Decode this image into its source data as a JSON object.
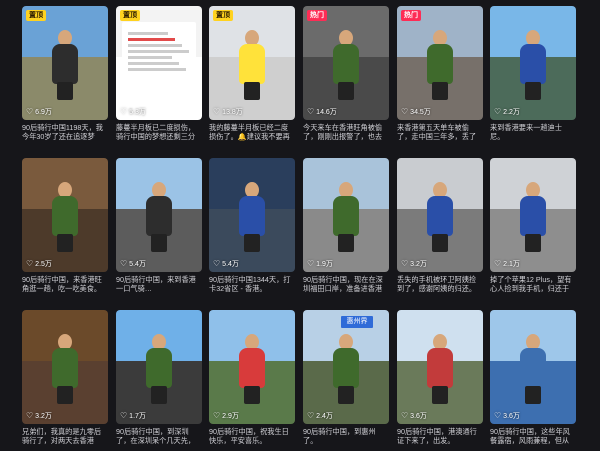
{
  "cards": [
    {
      "badge": "置顶",
      "badge_style": "yellow",
      "likes": "6.9万",
      "caption": "90后骑行中国1198天，我今年30岁了还在追逐梦想，有…",
      "sky": "#6aa2d6",
      "ground": "#8b8a6a",
      "shirt": "#2d2d2d"
    },
    {
      "badge": "置顶",
      "badge_style": "yellow",
      "likes": "5.3万",
      "caption": "藤蔓半月板已二度损伤，骑行中国的梦想还剩三分之一…",
      "sky": "#f3f3f3",
      "ground": "#ffffff",
      "shirt": "#ffffff"
    },
    {
      "badge": "置顶",
      "badge_style": "yellow",
      "likes": "13.8万",
      "caption": "我的藤蔓半月板已经二度损伤了。🔔建议我不要再继续骑…",
      "sky": "#dfe2e6",
      "ground": "#cfcfcf",
      "shirt": "#ffe23a"
    },
    {
      "badge": "热门",
      "badge_style": "red",
      "likes": "14.6万",
      "caption": "今天来车在香港旺角被偷了，刚刚出报警了，也去了趟警…",
      "sky": "#6b6b6b",
      "ground": "#4a4a4a",
      "shirt": "#3f6a2c"
    },
    {
      "badge": "热门",
      "badge_style": "red",
      "likes": "34.5万",
      "caption": "来香港第五天单车被偷了，走中国三年多，丢了32个省份…",
      "sky": "#9fb3c8",
      "ground": "#77706a",
      "shirt": "#3f6a2c"
    },
    {
      "badge": "",
      "badge_style": "yellow",
      "likes": "2.2万",
      "caption": "来到香港要来一趟迪士尼。",
      "sky": "#79b7e8",
      "ground": "#4c6b5a",
      "shirt": "#2a4fa8"
    },
    {
      "badge": "",
      "badge_style": "yellow",
      "likes": "2.5万",
      "caption": "90后骑行中国，来香港旺角逛一趟，吃一吃美食。",
      "sky": "#7a5a3d",
      "ground": "#4d3a2a",
      "shirt": "#3f6a2c"
    },
    {
      "badge": "",
      "badge_style": "yellow",
      "likes": "5.4万",
      "caption": "90后骑行中国，来到香港一口气骑…",
      "sky": "#9bc3e6",
      "ground": "#5c5c5c",
      "shirt": "#2d2d2d"
    },
    {
      "badge": "",
      "badge_style": "yellow",
      "likes": "5.4万",
      "caption": "90后骑行中国1344天，打卡32省区 - 香港。",
      "sky": "#2a3e5c",
      "ground": "#3b4a5c",
      "shirt": "#2a4fa8"
    },
    {
      "badge": "",
      "badge_style": "yellow",
      "likes": "1.9万",
      "caption": "90后骑行中国，现在在深圳福田口岸，准备进香港了，好…",
      "sky": "#a9c3da",
      "ground": "#8a8a8a",
      "shirt": "#3f6a2c"
    },
    {
      "badge": "",
      "badge_style": "yellow",
      "likes": "3.2万",
      "caption": "丢失的手机被环卫阿姨捡到了，感谢阿姨的归还。",
      "sky": "#c9ccd0",
      "ground": "#7b7b7b",
      "shirt": "#2a4fa8"
    },
    {
      "badge": "",
      "badge_style": "yellow",
      "likes": "2.1万",
      "caption": "掉了个苹果12 Plus，望有心人捡到我手机，归还于我。",
      "sky": "#cfd2d6",
      "ground": "#8e8e8e",
      "shirt": "#2a4fa8"
    },
    {
      "badge": "",
      "badge_style": "yellow",
      "likes": "3.2万",
      "caption": "兄弟们，我真的是九零后骑行了，对两天去香港啊。",
      "sky": "#6b4a2a",
      "ground": "#5a4030",
      "shirt": "#3f6a2c"
    },
    {
      "badge": "",
      "badge_style": "yellow",
      "likes": "1.7万",
      "caption": "90后骑行中国，到深圳了，在深圳呆个几天先，然后去香…",
      "sky": "#6fb0e8",
      "ground": "#3b3b3b",
      "shirt": "#3f6a2c"
    },
    {
      "badge": "",
      "badge_style": "yellow",
      "likes": "2.9万",
      "caption": "90后骑行中国，祝我生日快乐，平安喜乐。",
      "sky": "#8fc0ea",
      "ground": "#5a7a4a",
      "shirt": "#d83b3b"
    },
    {
      "badge": "",
      "badge_style": "yellow",
      "likes": "2.4万",
      "caption": "90后骑行中国，到惠州了。",
      "sky": "#b8d0e6",
      "ground": "#5a6a4a",
      "shirt": "#3f6a2c"
    },
    {
      "badge": "",
      "badge_style": "yellow",
      "likes": "3.6万",
      "caption": "90后骑行中国，港澳通行证下来了，出发。",
      "sky": "#cfe0ef",
      "ground": "#6a7a5a",
      "shirt": "#c23b3b"
    },
    {
      "badge": "",
      "badge_style": "yellow",
      "likes": "3.6万",
      "caption": "90后骑行中国，这些年风餐露宿，风雨兼程，但从未想过…",
      "sky": "#9ec7ea",
      "ground": "#3d6fb0",
      "shirt": "#3d6fb0"
    }
  ],
  "extras": {
    "sign_label": "惠州界",
    "doc_title": "诊断证明"
  }
}
